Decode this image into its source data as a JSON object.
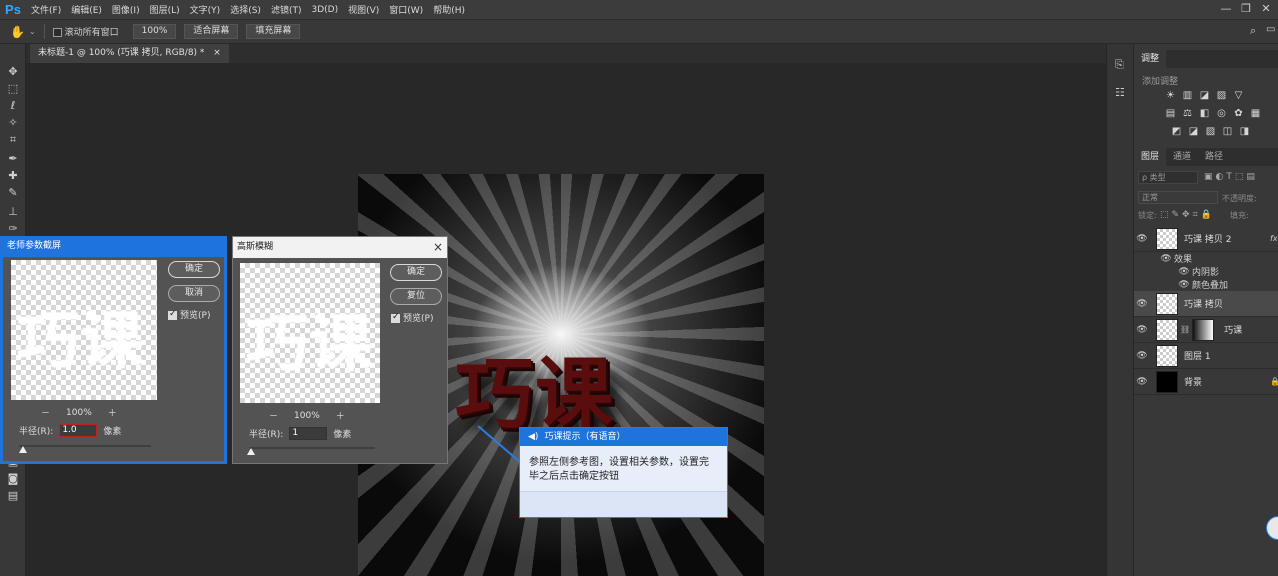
{
  "app": {
    "logo": "Ps"
  },
  "menu": [
    "文件(F)",
    "编辑(E)",
    "图像(I)",
    "图层(L)",
    "文字(Y)",
    "选择(S)",
    "滤镜(T)",
    "3D(D)",
    "视图(V)",
    "窗口(W)",
    "帮助(H)"
  ],
  "window_controls": {
    "minimize": "—",
    "restore": "❐",
    "close": "✕"
  },
  "options": {
    "scroll_all": "滚动所有窗口",
    "zoom": "100%",
    "fit_screen": "适合屏幕",
    "fill_screen": "填充屏幕"
  },
  "document": {
    "tab_title": "未标题-1 @ 100% (巧课 拷贝, RGB/8) *",
    "close": "×",
    "hero_text": "巧课"
  },
  "panels": {
    "adjust_tab": "调整",
    "adjust_hint": "添加调整",
    "adjust_icons_row1": [
      "☀",
      "▥",
      "◪",
      "▨",
      "▽"
    ],
    "adjust_icons_row2": [
      "▤",
      "⚖",
      "◧",
      "◎",
      "✿",
      "▦"
    ],
    "adjust_icons_row3": [
      "◩",
      "◪",
      "▨",
      "◫",
      "◨"
    ],
    "layer_tabs": [
      "图层",
      "通道",
      "路径"
    ],
    "kind_filter": "ρ 类型",
    "blend_mode": "正常",
    "opacity_label": "不透明度:",
    "lock_label": "锁定:",
    "fill_label": "填充:",
    "layers": [
      {
        "name": "巧课 拷贝 2",
        "fx": "fx"
      },
      {
        "name": "巧课 拷贝"
      },
      {
        "name": "巧课"
      },
      {
        "name": "图层 1"
      },
      {
        "name": "背景"
      }
    ],
    "effects_label": "效果",
    "effects": [
      "内阴影",
      "颜色叠加"
    ]
  },
  "dialog_ref": {
    "title": "老师参数截屏",
    "preview_text": "巧课",
    "ok": "确定",
    "cancel": "取消",
    "preview_label": "预览(P)",
    "zoom": "100%",
    "radius_label": "半径(R):",
    "radius_value": "1.0",
    "unit": "像素",
    "zoom_out": "－",
    "zoom_in": "＋"
  },
  "dialog_gauss": {
    "title": "高斯模糊",
    "close": "×",
    "preview_text": "巧课",
    "ok": "确定",
    "reset": "复位",
    "preview_label": "预览(P)",
    "zoom": "100%",
    "radius_label": "半径(R):",
    "radius_value": "1",
    "unit": "像素",
    "zoom_out": "－",
    "zoom_in": "＋"
  },
  "tip": {
    "header": "巧课提示（有语音）",
    "speaker": "◀)",
    "body": "参照左侧参考图，设置相关参数，设置完毕之后点击确定按钮"
  },
  "colors": {
    "accent": "#1f73dd",
    "hero": "#5a0d0d",
    "ps_blue": "#30a8ff"
  }
}
